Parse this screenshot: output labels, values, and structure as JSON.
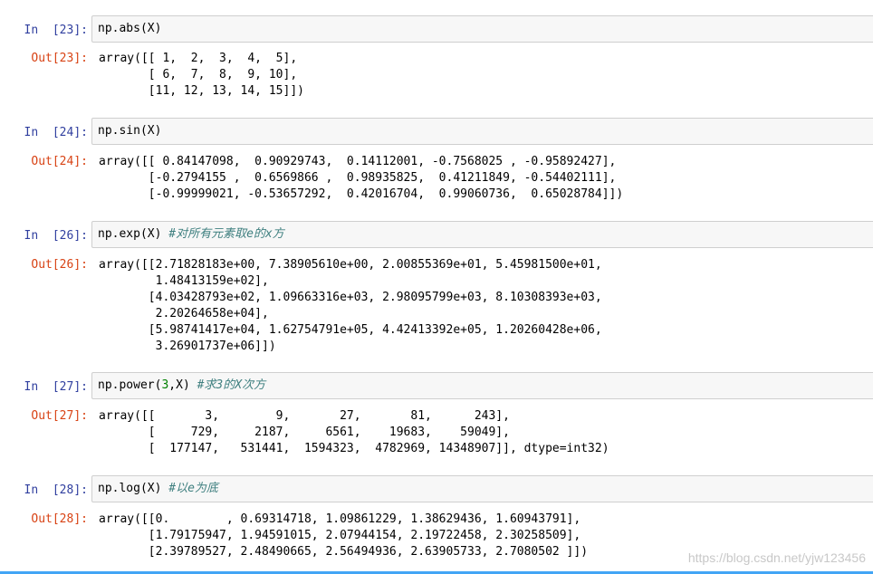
{
  "cells": [
    {
      "in_prompt": "In  [23]:",
      "code": {
        "fn": "np.abs",
        "open": "(",
        "args": "X",
        "close": ")",
        "comment": ""
      },
      "out_prompt": "Out[23]:",
      "output": "array([[ 1,  2,  3,  4,  5],\n       [ 6,  7,  8,  9, 10],\n       [11, 12, 13, 14, 15]])"
    },
    {
      "in_prompt": "In  [24]:",
      "code": {
        "fn": "np.sin",
        "open": "(",
        "args": "X",
        "close": ")",
        "comment": ""
      },
      "out_prompt": "Out[24]:",
      "output": "array([[ 0.84147098,  0.90929743,  0.14112001, -0.7568025 , -0.95892427],\n       [-0.2794155 ,  0.6569866 ,  0.98935825,  0.41211849, -0.54402111],\n       [-0.99999021, -0.53657292,  0.42016704,  0.99060736,  0.65028784]])"
    },
    {
      "in_prompt": "In  [26]:",
      "code": {
        "fn": "np.exp",
        "open": "(",
        "args": "X",
        "close": ")",
        "comment": "#对所有元素取e的x方"
      },
      "out_prompt": "Out[26]:",
      "output": "array([[2.71828183e+00, 7.38905610e+00, 2.00855369e+01, 5.45981500e+01,\n        1.48413159e+02],\n       [4.03428793e+02, 1.09663316e+03, 2.98095799e+03, 8.10308393e+03,\n        2.20264658e+04],\n       [5.98741417e+04, 1.62754791e+05, 4.42413392e+05, 1.20260428e+06,\n        3.26901737e+06]])"
    },
    {
      "in_prompt": "In  [27]:",
      "code": {
        "fn": "np.power",
        "open": "(",
        "num": "3",
        "args": ",X",
        "close": ")",
        "comment": "#求3的X次方"
      },
      "out_prompt": "Out[27]:",
      "output": "array([[       3,        9,       27,       81,      243],\n       [     729,     2187,     6561,    19683,    59049],\n       [  177147,   531441,  1594323,  4782969, 14348907]], dtype=int32)"
    },
    {
      "in_prompt": "In  [28]:",
      "code": {
        "fn": "np.log",
        "open": "(",
        "args": "X",
        "close": ")",
        "comment": "#以e为底"
      },
      "out_prompt": "Out[28]:",
      "output": "array([[0.        , 0.69314718, 1.09861229, 1.38629436, 1.60943791],\n       [1.79175947, 1.94591015, 2.07944154, 2.19722458, 2.30258509],\n       [2.39789527, 2.48490665, 2.56494936, 2.63905733, 2.7080502 ]])"
    }
  ],
  "watermark": "https://blog.csdn.net/yjw123456",
  "colors": {
    "in_prompt": "#303f9f",
    "out_prompt": "#d84315",
    "number": "#008000",
    "comment": "#408080",
    "input_bg": "#f7f7f7"
  }
}
